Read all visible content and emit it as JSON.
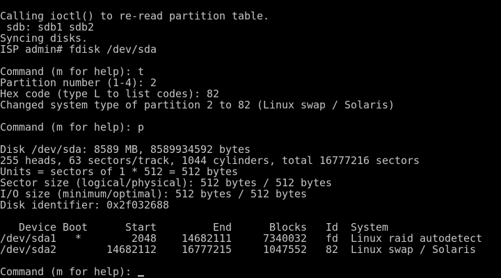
{
  "terminal": {
    "text_color": "#c6c6c6",
    "background_color": "#000000",
    "lines": [
      "Calling ioctl() to re-read partition table.",
      " sdb: sdb1 sdb2",
      "Syncing disks.",
      "ISP admin# fdisk /dev/sda",
      "",
      "Command (m for help): t",
      "Partition number (1-4): 2",
      "Hex code (type L to list codes): 82",
      "Changed system type of partition 2 to 82 (Linux swap / Solaris)",
      "",
      "Command (m for help): p",
      "",
      "Disk /dev/sda: 8589 MB, 8589934592 bytes",
      "255 heads, 63 sectors/track, 1044 cylinders, total 16777216 sectors",
      "Units = sectors of 1 * 512 = 512 bytes",
      "Sector size (logical/physical): 512 bytes / 512 bytes",
      "I/O size (minimum/optimal): 512 bytes / 512 bytes",
      "Disk identifier: 0x2f032688",
      "",
      "   Device Boot      Start         End      Blocks   Id  System",
      "/dev/sda1   *        2048    14682111     7340032   fd  Linux raid autodetect",
      "/dev/sda2        14682112    16777215     1047552   82  Linux swap / Solaris",
      ""
    ],
    "prompt_line": "Command (m for help): "
  }
}
